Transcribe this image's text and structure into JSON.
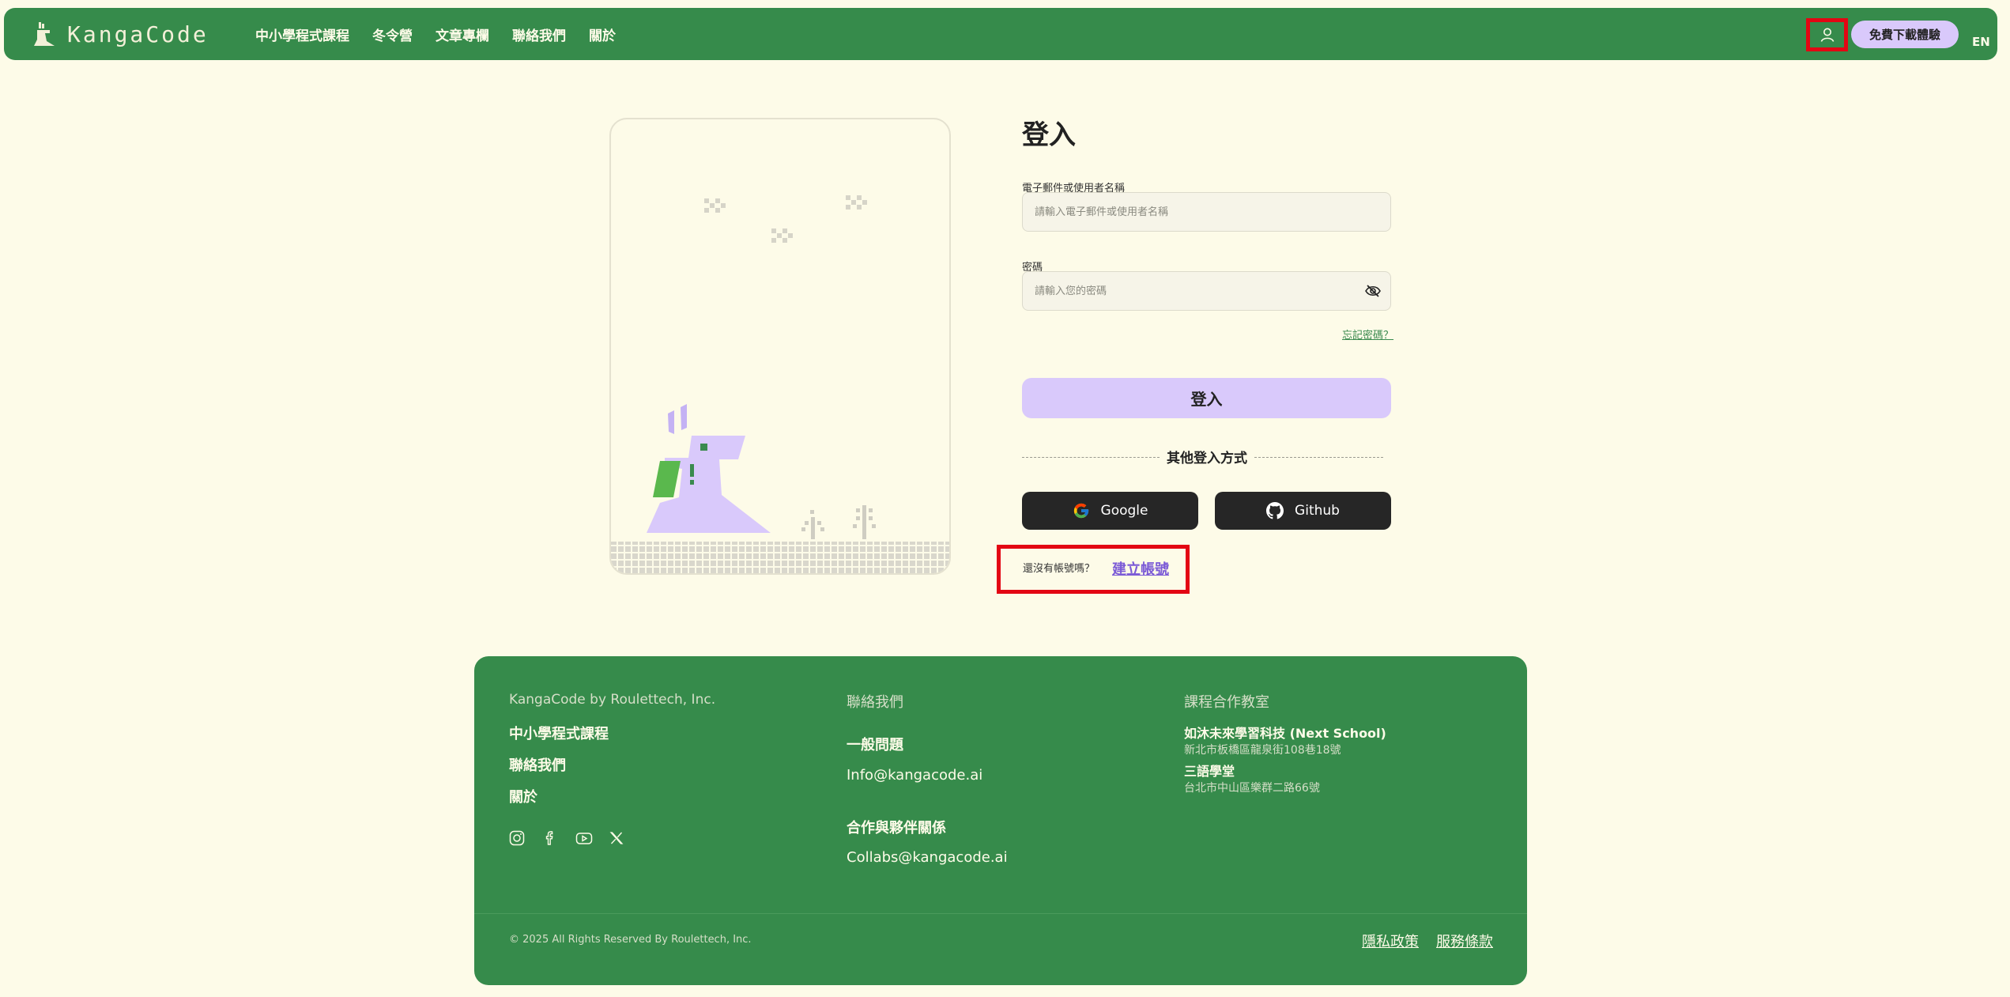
{
  "header": {
    "brand": "KangaCode",
    "nav": [
      "中小學程式課程",
      "冬令營",
      "文章專欄",
      "聯絡我們",
      "關於"
    ],
    "download_label": "免費下載體驗",
    "lang_label": "EN"
  },
  "login": {
    "title": "登入",
    "email_label": "電子郵件或使用者名稱",
    "email_placeholder": "請輸入電子郵件或使用者名稱",
    "password_label": "密碼",
    "password_placeholder": "請輸入您的密碼",
    "forgot_label": "忘記密碼？",
    "submit_label": "登入",
    "other_methods_label": "其他登入方式",
    "google_label": "Google",
    "github_label": "Github",
    "no_account_label": "還沒有帳號嗎？",
    "create_account_label": "建立帳號"
  },
  "footer": {
    "company": "KangaCode by Roulettech, Inc.",
    "links": [
      "中小學程式課程",
      "聯絡我們",
      "關於"
    ],
    "social_icons": [
      "instagram-icon",
      "facebook-icon",
      "youtube-icon",
      "x-icon"
    ],
    "contact": {
      "heading": "聯絡我們",
      "general_title": "一般問題",
      "general_email": "Info@kangacode.ai",
      "collab_title": "合作與夥伴關係",
      "collab_email": "Collabs@kangacode.ai"
    },
    "partners": {
      "heading": "課程合作教室",
      "items": [
        {
          "name": "如沐未來學習科技 (Next School)",
          "address": "新北市板橋區龍泉街108巷18號"
        },
        {
          "name": "三語學堂",
          "address": "台北市中山區樂群二路66號"
        }
      ]
    },
    "copyright": "© 2025 All Rights Reserved By Roulettech, Inc.",
    "privacy_label": "隱私政策",
    "terms_label": "服務條款"
  },
  "colors": {
    "brand_green": "#368b4b",
    "accent_lavender": "#d9c9fb",
    "page_background": "#fdfbe8",
    "highlight_red": "#e30613",
    "link_purple": "#7b5ad6"
  }
}
